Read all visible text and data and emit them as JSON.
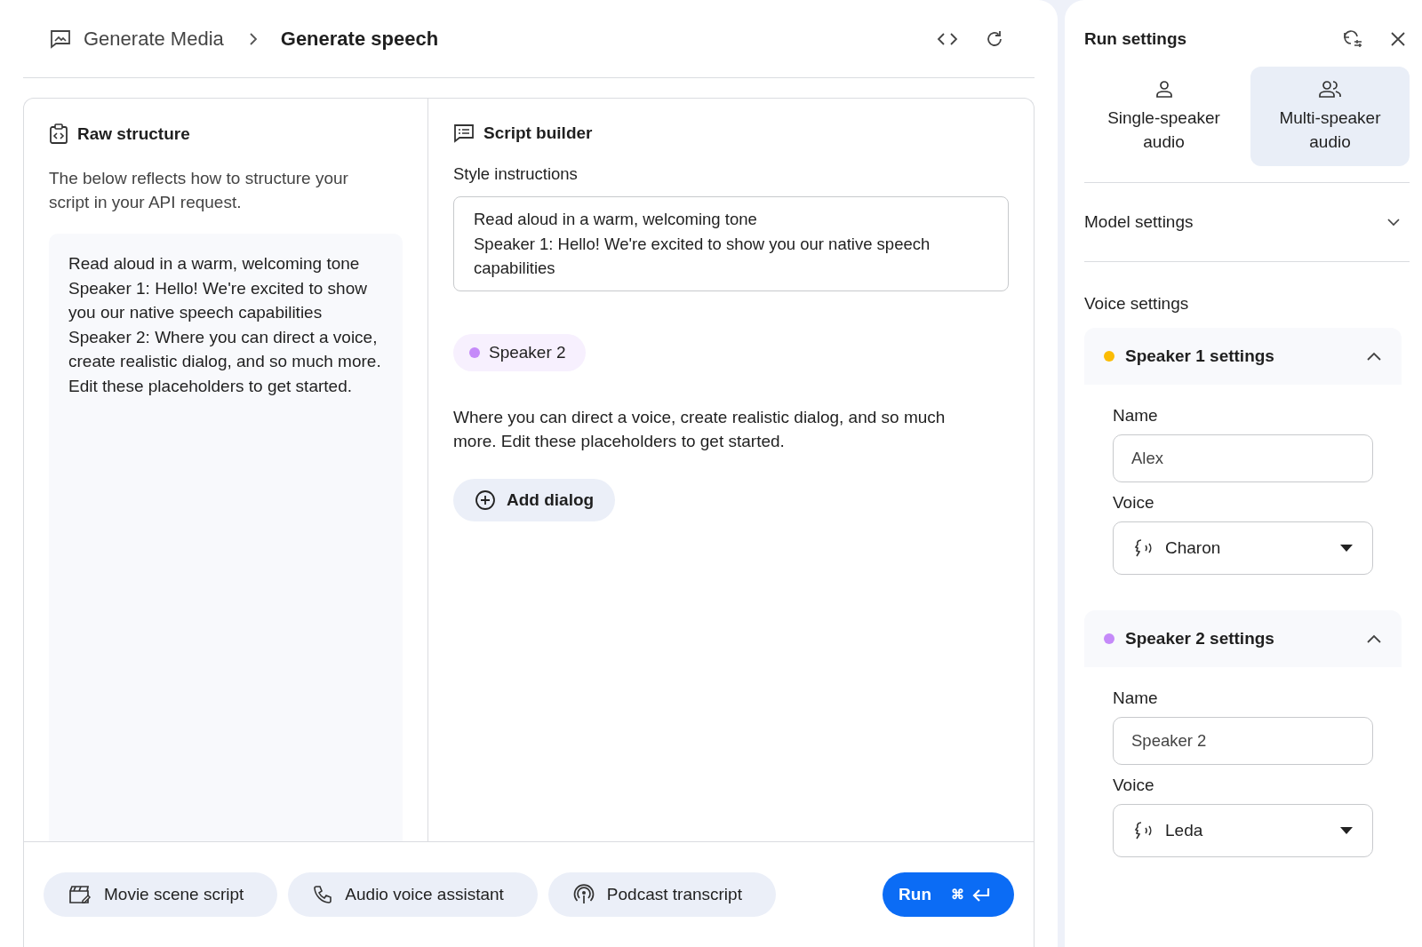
{
  "header": {
    "breadcrumb": [
      "Generate Media",
      "Generate speech"
    ]
  },
  "raw_structure": {
    "title": "Raw structure",
    "description": "The below reflects how to structure your script in your API request.",
    "lines": [
      "Read aloud in a warm, welcoming tone",
      "Speaker 1: Hello! We're excited to show you our native speech capabilities",
      "Speaker 2: Where you can direct a voice, create realistic dialog, and so much more. Edit these placeholders to get started."
    ]
  },
  "script_builder": {
    "title": "Script builder",
    "style_label": "Style instructions",
    "style_lines": [
      "Read aloud in a warm, welcoming tone",
      "Speaker 1: Hello! We're excited to show you our native speech capabilities"
    ],
    "dialogs": [
      {
        "speaker": "Speaker 2",
        "color": "#c58af9",
        "text": "Where you can direct a voice, create realistic dialog, and so much more. Edit these placeholders to get started."
      }
    ],
    "add_button": "Add dialog"
  },
  "footer": {
    "templates": [
      {
        "label": "Movie scene script",
        "kind": "movie"
      },
      {
        "label": "Audio voice assistant",
        "kind": "phone"
      },
      {
        "label": "Podcast transcript",
        "kind": "podcast"
      }
    ],
    "run": {
      "label": "Run",
      "shortcut": "⌘"
    }
  },
  "run_settings": {
    "title": "Run settings",
    "modes": [
      {
        "label": "Single-speaker audio",
        "kind": "single",
        "selected": false
      },
      {
        "label": "Multi-speaker audio",
        "kind": "multi",
        "selected": true
      }
    ],
    "model_settings": {
      "label": "Model settings",
      "expanded": false
    },
    "voice_settings": "Voice settings",
    "speakers": [
      {
        "title": "Speaker 1 settings",
        "color": "#fbbc04",
        "expanded": true,
        "name_label": "Name",
        "name_value": "Alex",
        "voice_label": "Voice",
        "voice_value": "Charon"
      },
      {
        "title": "Speaker 2 settings",
        "color": "#c58af9",
        "expanded": true,
        "name_label": "Name",
        "name_value": "Speaker 2",
        "voice_label": "Voice",
        "voice_value": "Leda"
      }
    ]
  }
}
